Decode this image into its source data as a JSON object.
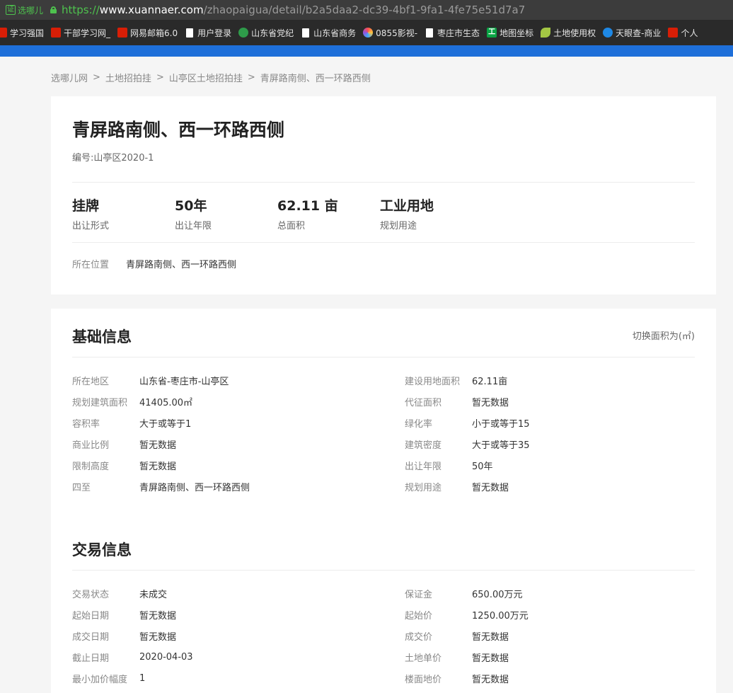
{
  "browser": {
    "cert_label": "选哪儿",
    "cert_icon": "证",
    "url_scheme": "https://",
    "url_host": "www.xuannaer.com",
    "url_path": "/zhaopaigua/detail/b2a5daa2-dc39-4bf1-9fa1-4fe75e51d7a7",
    "bookmarks": [
      {
        "label": "学习强国",
        "icon": "red"
      },
      {
        "label": "干部学习网_",
        "icon": "red"
      },
      {
        "label": "网易邮箱6.0",
        "icon": "red"
      },
      {
        "label": "用户登录",
        "icon": "doc"
      },
      {
        "label": "山东省党纪",
        "icon": "globe"
      },
      {
        "label": "山东省商务",
        "icon": "doc"
      },
      {
        "label": "0855影视-",
        "icon": "colorful"
      },
      {
        "label": "枣庄市生态",
        "icon": "doc"
      },
      {
        "label": "地图坐标",
        "icon": "green"
      },
      {
        "label": "土地使用权",
        "icon": "leaf"
      },
      {
        "label": "天眼查-商业",
        "icon": "edge"
      },
      {
        "label": "个人",
        "icon": "red"
      }
    ]
  },
  "breadcrumb": [
    "选哪儿网",
    "土地招拍挂",
    "山亭区土地招拍挂",
    "青屏路南侧、西一环路西侧"
  ],
  "header": {
    "title": "青屏路南侧、西一环路西侧",
    "code": "编号:山亭区2020-1",
    "stats": [
      {
        "value": "挂牌",
        "label": "出让形式"
      },
      {
        "value": "50年",
        "label": "出让年限"
      },
      {
        "value": "62.11 亩",
        "label": "总面积"
      },
      {
        "value": "工业用地",
        "label": "规划用途"
      }
    ],
    "location_label": "所在位置",
    "location_value": "青屏路南侧、西一环路西侧"
  },
  "basic": {
    "title": "基础信息",
    "switch_label": "切换面积为(㎡)",
    "left": [
      {
        "k": "所在地区",
        "v": "山东省-枣庄市-山亭区"
      },
      {
        "k": "规划建筑面积",
        "v": "41405.00㎡"
      },
      {
        "k": "容积率",
        "v": "大于或等于1"
      },
      {
        "k": "商业比例",
        "v": "暂无数据"
      },
      {
        "k": "限制高度",
        "v": "暂无数据"
      },
      {
        "k": "四至",
        "v": "青屏路南侧、西一环路西侧"
      }
    ],
    "right": [
      {
        "k": "建设用地面积",
        "v": "62.11亩"
      },
      {
        "k": "代征面积",
        "v": "暂无数据"
      },
      {
        "k": "绿化率",
        "v": "小于或等于15"
      },
      {
        "k": "建筑密度",
        "v": "大于或等于35"
      },
      {
        "k": "出让年限",
        "v": "50年"
      },
      {
        "k": "规划用途",
        "v": "暂无数据"
      }
    ]
  },
  "trade": {
    "title": "交易信息",
    "left": [
      {
        "k": "交易状态",
        "v": "未成交"
      },
      {
        "k": "起始日期",
        "v": "暂无数据"
      },
      {
        "k": "成交日期",
        "v": "暂无数据"
      },
      {
        "k": "截止日期",
        "v": "2020-04-03"
      },
      {
        "k": "最小加价幅度",
        "v": "1"
      }
    ],
    "right": [
      {
        "k": "保证金",
        "v": "650.00万元"
      },
      {
        "k": "起始价",
        "v": "1250.00万元"
      },
      {
        "k": "成交价",
        "v": "暂无数据"
      },
      {
        "k": "土地单价",
        "v": "暂无数据"
      },
      {
        "k": "楼面地价",
        "v": "暂无数据"
      }
    ]
  }
}
